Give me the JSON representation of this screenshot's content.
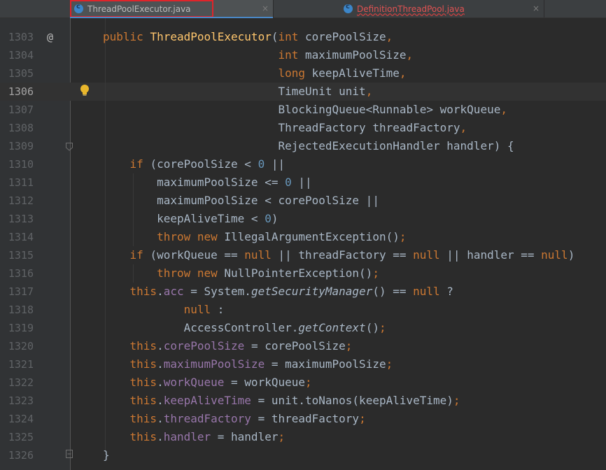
{
  "tabs": [
    {
      "label": "ThreadPoolExecutor.java",
      "icon": "java-class-icon",
      "active": true
    },
    {
      "label": "DefinitionThreadPool.java",
      "icon": "java-class-icon",
      "active": false,
      "has_error": true
    }
  ],
  "close_glyph": "×",
  "gutter": {
    "line_numbers": [
      "1303",
      "1304",
      "1305",
      "1306",
      "1307",
      "1308",
      "1309",
      "1310",
      "1311",
      "1312",
      "1313",
      "1314",
      "1315",
      "1316",
      "1317",
      "1318",
      "1319",
      "1320",
      "1321",
      "1322",
      "1323",
      "1324",
      "1325",
      "1326"
    ],
    "current_line": "1306",
    "override_marker": "@"
  },
  "code_lines": [
    [
      [
        "kw",
        "public "
      ],
      [
        "fn",
        "ThreadPoolExecutor"
      ],
      [
        "p",
        "("
      ],
      [
        "kw",
        "int "
      ],
      [
        "p",
        "corePoolSize"
      ],
      [
        "kw",
        ","
      ]
    ],
    [
      [
        "sp",
        "                          "
      ],
      [
        "kw",
        "int "
      ],
      [
        "p",
        "maximumPoolSize"
      ],
      [
        "kw",
        ","
      ]
    ],
    [
      [
        "sp",
        "                          "
      ],
      [
        "kw",
        "long "
      ],
      [
        "p",
        "keepAliveTime"
      ],
      [
        "kw",
        ","
      ]
    ],
    [
      [
        "sp",
        "                          "
      ],
      [
        "p",
        "TimeUnit unit"
      ],
      [
        "kw",
        ","
      ]
    ],
    [
      [
        "sp",
        "                          "
      ],
      [
        "p",
        "BlockingQueue<Runnable> workQueue"
      ],
      [
        "kw",
        ","
      ]
    ],
    [
      [
        "sp",
        "                          "
      ],
      [
        "p",
        "ThreadFactory threadFactory"
      ],
      [
        "kw",
        ","
      ]
    ],
    [
      [
        "sp",
        "                          "
      ],
      [
        "p",
        "RejectedExecutionHandler handler) {"
      ]
    ],
    [
      [
        "sp",
        "    "
      ],
      [
        "kw",
        "if "
      ],
      [
        "p",
        "(corePoolSize < "
      ],
      [
        "num",
        "0"
      ],
      [
        "p",
        " ||"
      ]
    ],
    [
      [
        "sp",
        "        "
      ],
      [
        "p",
        "maximumPoolSize <= "
      ],
      [
        "num",
        "0"
      ],
      [
        "p",
        " ||"
      ]
    ],
    [
      [
        "sp",
        "        "
      ],
      [
        "p",
        "maximumPoolSize < corePoolSize ||"
      ]
    ],
    [
      [
        "sp",
        "        "
      ],
      [
        "p",
        "keepAliveTime < "
      ],
      [
        "num",
        "0"
      ],
      [
        "p",
        ")"
      ]
    ],
    [
      [
        "sp",
        "        "
      ],
      [
        "kw",
        "throw new "
      ],
      [
        "p",
        "IllegalArgumentException()"
      ],
      [
        "kw",
        ";"
      ]
    ],
    [
      [
        "sp",
        "    "
      ],
      [
        "kw",
        "if "
      ],
      [
        "p",
        "(workQueue == "
      ],
      [
        "kw",
        "null "
      ],
      [
        "p",
        "|| threadFactory == "
      ],
      [
        "kw",
        "null "
      ],
      [
        "p",
        "|| handler == "
      ],
      [
        "kw",
        "null"
      ],
      [
        "p",
        ")"
      ]
    ],
    [
      [
        "sp",
        "        "
      ],
      [
        "kw",
        "throw new "
      ],
      [
        "p",
        "NullPointerException()"
      ],
      [
        "kw",
        ";"
      ]
    ],
    [
      [
        "sp",
        "    "
      ],
      [
        "kw",
        "this"
      ],
      [
        "p",
        "."
      ],
      [
        "fld",
        "acc "
      ],
      [
        "p",
        "= System."
      ],
      [
        "it",
        "getSecurityManager"
      ],
      [
        "p",
        "() == "
      ],
      [
        "kw",
        "null "
      ],
      [
        "p",
        "?"
      ]
    ],
    [
      [
        "sp",
        "            "
      ],
      [
        "kw",
        "null "
      ],
      [
        "p",
        ":"
      ]
    ],
    [
      [
        "sp",
        "            "
      ],
      [
        "p",
        "AccessController."
      ],
      [
        "it",
        "getContext"
      ],
      [
        "p",
        "()"
      ],
      [
        "kw",
        ";"
      ]
    ],
    [
      [
        "sp",
        "    "
      ],
      [
        "kw",
        "this"
      ],
      [
        "p",
        "."
      ],
      [
        "fld",
        "corePoolSize "
      ],
      [
        "p",
        "= corePoolSize"
      ],
      [
        "kw",
        ";"
      ]
    ],
    [
      [
        "sp",
        "    "
      ],
      [
        "kw",
        "this"
      ],
      [
        "p",
        "."
      ],
      [
        "fld",
        "maximumPoolSize "
      ],
      [
        "p",
        "= maximumPoolSize"
      ],
      [
        "kw",
        ";"
      ]
    ],
    [
      [
        "sp",
        "    "
      ],
      [
        "kw",
        "this"
      ],
      [
        "p",
        "."
      ],
      [
        "fld",
        "workQueue "
      ],
      [
        "p",
        "= workQueue"
      ],
      [
        "kw",
        ";"
      ]
    ],
    [
      [
        "sp",
        "    "
      ],
      [
        "kw",
        "this"
      ],
      [
        "p",
        "."
      ],
      [
        "fld",
        "keepAliveTime "
      ],
      [
        "p",
        "= unit.toNanos(keepAliveTime)"
      ],
      [
        "kw",
        ";"
      ]
    ],
    [
      [
        "sp",
        "    "
      ],
      [
        "kw",
        "this"
      ],
      [
        "p",
        "."
      ],
      [
        "fld",
        "threadFactory "
      ],
      [
        "p",
        "= threadFactory"
      ],
      [
        "kw",
        ";"
      ]
    ],
    [
      [
        "sp",
        "    "
      ],
      [
        "kw",
        "this"
      ],
      [
        "p",
        "."
      ],
      [
        "fld",
        "handler "
      ],
      [
        "p",
        "= handler"
      ],
      [
        "kw",
        ";"
      ]
    ],
    [
      [
        "p",
        "}"
      ]
    ]
  ],
  "colors": {
    "background": "#2b2b2b",
    "keyword": "#cc7832",
    "field": "#9876aa",
    "method_decl": "#ffc66d",
    "number": "#6897bb",
    "text": "#a9b7c6",
    "highlight_frame": "#e0242a"
  }
}
